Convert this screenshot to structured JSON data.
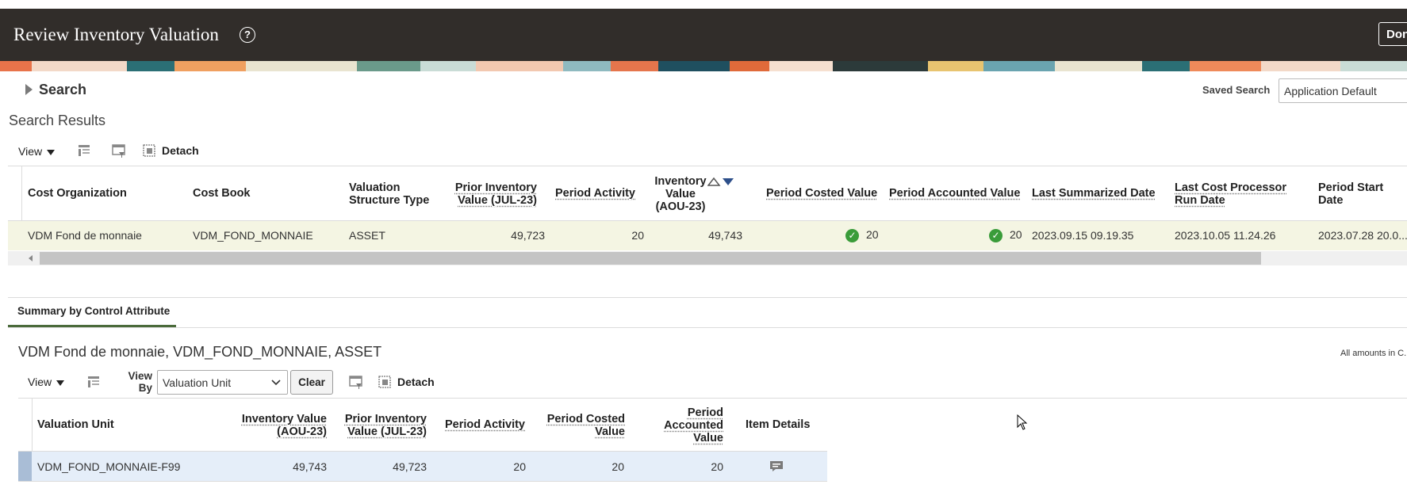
{
  "header": {
    "title": "Review Inventory Valuation",
    "help_icon": "question-circle-icon",
    "done_label": "Done"
  },
  "search": {
    "label": "Search",
    "saved_search_label": "Saved Search",
    "saved_search_value": "Application Default"
  },
  "results": {
    "title": "Search Results",
    "toolbar": {
      "view_label": "View",
      "detach_label": "Detach"
    },
    "columns": [
      "Cost Organization",
      "Cost Book",
      "Valuation Structure Type",
      "Prior Inventory Value (JUL-23)",
      "Period Activity",
      "Inventory Value (AOU-23)",
      "Period Costed Value",
      "Period Accounted Value",
      "Last Summarized Date",
      "Last Cost Processor Run Date",
      "Period Start Date"
    ],
    "rows": [
      {
        "cost_org": "VDM Fond de monnaie",
        "cost_book": "VDM_FOND_MONNAIE",
        "structure_type": "ASSET",
        "prior_value": "49,723",
        "period_activity": "20",
        "inventory_value": "49,743",
        "costed_value": "20",
        "accounted_value": "20",
        "last_summarized": "2023.09.15 09.19.35",
        "last_cost_run": "2023.10.05 11.24.26",
        "period_start": "2023.07.28 20.0..."
      }
    ]
  },
  "summary": {
    "tab_label": "Summary by Control Attribute",
    "title": "VDM Fond de monnaie, VDM_FOND_MONNAIE, ASSET",
    "amounts_note": "All amounts in C...",
    "toolbar": {
      "view_label": "View",
      "view_by_label": "View By",
      "view_by_value": "Valuation Unit",
      "clear_label": "Clear",
      "detach_label": "Detach"
    },
    "columns": [
      "Valuation Unit",
      "Inventory Value (AOU-23)",
      "Prior Inventory Value (JUL-23)",
      "Period Activity",
      "Period Costed Value",
      "Period Accounted Value",
      "Item Details"
    ],
    "rows": [
      {
        "valuation_unit": "VDM_FOND_MONNAIE-F99",
        "inventory_value": "49,743",
        "prior_value": "49,723",
        "period_activity": "20",
        "costed_value": "20",
        "accounted_value": "20",
        "item_details_icon": "details-icon"
      }
    ]
  },
  "colors": {
    "header_bg": "#312d2a",
    "selected_row": "#f4f5e3",
    "summary_row": "#e5eef9",
    "success": "#3a9c3a"
  }
}
